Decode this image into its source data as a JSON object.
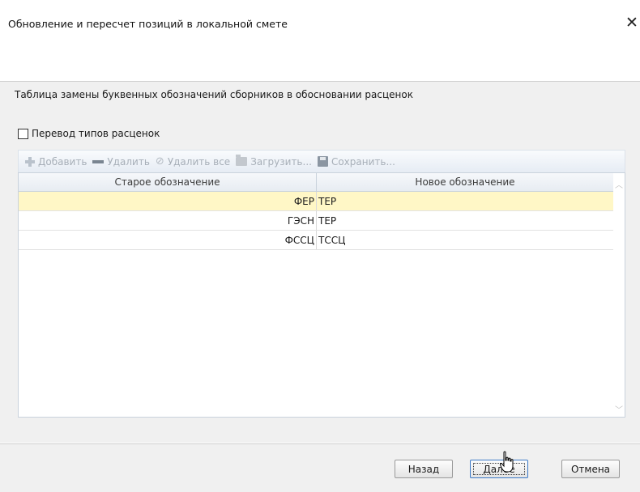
{
  "window": {
    "title": "Обновление и пересчет позиций в локальной смете",
    "close_glyph": "✕"
  },
  "description": "Таблица замены буквенных обозначений сборников в обосновании расценок",
  "conversion_checkbox": {
    "label": "Перевод типов расценок",
    "checked": false
  },
  "toolbar": {
    "add": {
      "label": "Добавить",
      "icon": "plus-icon"
    },
    "delete": {
      "label": "Удалить",
      "icon": "minus-icon"
    },
    "delete_all": {
      "label": "Удалить все",
      "icon": "clear-icon"
    },
    "load": {
      "label": "Загрузить...",
      "icon": "folder-icon"
    },
    "save": {
      "label": "Сохранить...",
      "icon": "floppy-icon"
    }
  },
  "grid": {
    "columns": [
      "Старое обозначение",
      "Новое обозначение"
    ],
    "rows": [
      {
        "old": "ФЕР",
        "new": "ТЕР",
        "selected": true
      },
      {
        "old": "ГЭСН",
        "new": "ТЕР",
        "selected": false
      },
      {
        "old": "ФССЦ",
        "new": "ТССЦ",
        "selected": false
      }
    ],
    "selected_row_color": "#fff7c6"
  },
  "buttons": {
    "back": "Назад",
    "next": "Далее",
    "cancel": "Отмена"
  }
}
